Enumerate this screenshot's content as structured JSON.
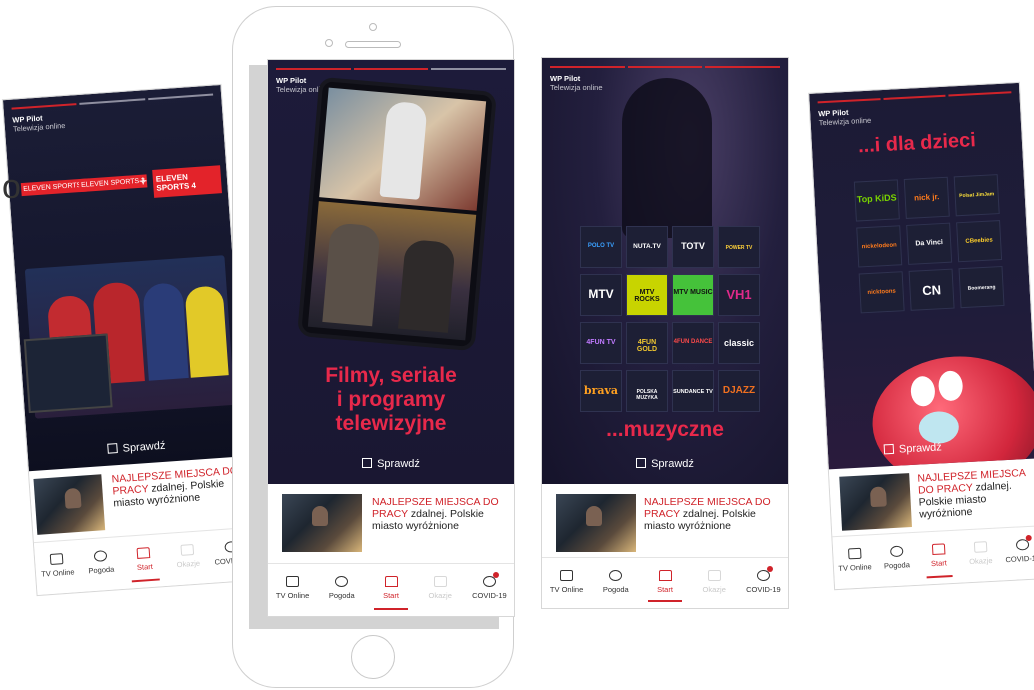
{
  "app": {
    "title": "WP Pilot",
    "subtitle": "Telewizja online"
  },
  "cta_label": "Sprawdź",
  "news": {
    "headline_red": "NAJLEPSZE MIEJSCA DO PRACY",
    "headline_rest": "zdalnej. Polskie miasto wyróżnione"
  },
  "tabs": [
    {
      "label": "TV Online",
      "icon": "tv-play-icon"
    },
    {
      "label": "Pogoda",
      "icon": "weather-icon"
    },
    {
      "label": "Start",
      "icon": "home-icon"
    },
    {
      "label": "Okazje",
      "icon": "cart-icon"
    },
    {
      "label": "COVID-19",
      "icon": "virus-icon"
    }
  ],
  "active_tab": "Start",
  "colors": {
    "accent": "#d0232a",
    "hero_bg": "#1c1a36"
  },
  "screens": {
    "sport": {
      "channels": [
        "ELEVEN SPORTS 2",
        "ELEVEN SPORTS 3",
        "+",
        "ELEVEN SPORTS 4"
      ],
      "partial_text": "o"
    },
    "movies": {
      "headline": [
        "Filmy, seriale",
        "i programy",
        "telewizyjne"
      ]
    },
    "music": {
      "headline": "...muzyczne",
      "channels": [
        "POLO TV",
        "NUTA.TV",
        "TOTV",
        "POWER TV",
        "MTV",
        "MTV ROCKS",
        "MTV MUSIC",
        "VH1",
        "4FUN TV",
        "4FUN GOLD",
        "4FUN DANCE",
        "classic",
        "brava",
        "POLSKA MUZYKA",
        "SUNDANCE TV",
        "DJAZZ"
      ]
    },
    "kids": {
      "headline": "...i dla dzieci",
      "channels": [
        "Top KiDS",
        "nick jr.",
        "Polsat JimJam",
        "nickelodeon",
        "Da Vinci",
        "CBeebies",
        "nicktoons",
        "CN",
        "Boomerang"
      ]
    }
  }
}
